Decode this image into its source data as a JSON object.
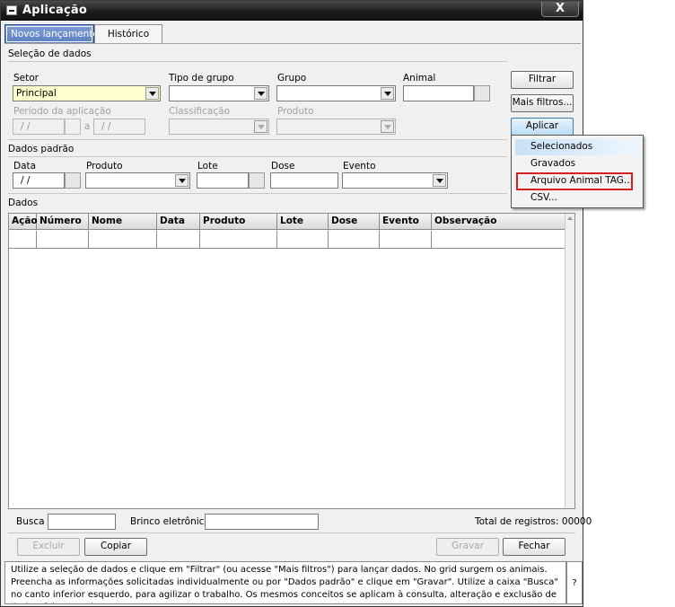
{
  "window": {
    "title": "Aplicação",
    "close_label": "X"
  },
  "tabs": [
    {
      "label": "Novos lançamentos",
      "active": true
    },
    {
      "label": "Histórico",
      "active": false
    }
  ],
  "selecao": {
    "header": "Seleção de dados",
    "setor_label": "Setor",
    "setor_value": "Principal",
    "tipo_grupo_label": "Tipo de grupo",
    "grupo_label": "Grupo",
    "animal_label": "Animal",
    "periodo_label": "Período da aplicação",
    "periodo_de": " / /",
    "periodo_sep": "a",
    "periodo_ate": " / /",
    "classificacao_label": "Classificação",
    "produto_label": "Produto"
  },
  "buttons": {
    "filtrar": "Filtrar",
    "mais_filtros": "Mais filtros...",
    "aplicar": "Aplicar"
  },
  "aplicar_menu": [
    {
      "label": "Selecionados"
    },
    {
      "label": "Gravados"
    },
    {
      "label": "Arquivo Animal TAG..."
    },
    {
      "label": "CSV..."
    }
  ],
  "dados_padrao": {
    "header": "Dados padrão",
    "data_label": "Data",
    "data_value": " / /",
    "produto_label": "Produto",
    "lote_label": "Lote",
    "dose_label": "Dose",
    "evento_label": "Evento"
  },
  "dados": {
    "header": "Dados",
    "columns": [
      "Ação",
      "Número",
      "Nome",
      "Data",
      "Produto",
      "Lote",
      "Dose",
      "Evento",
      "Observação"
    ]
  },
  "footer": {
    "busca_label": "Busca",
    "brinco_label": "Brinco eletrônico",
    "total_label": "Total de registros: 00000",
    "excluir": "Excluir",
    "copiar": "Copiar",
    "gravar": "Gravar",
    "fechar": "Fechar"
  },
  "help": {
    "text": "Utilize a seleção de dados e clique em \"Filtrar\" (ou acesse \"Mais filtros\") para lançar dados. No grid surgem os animais. Preencha as informações solicitadas individualmente ou por \"Dados padrão\" e clique em  \"Gravar\". Utilize a caixa \"Busca\" no canto inferior esquerdo, para agilizar o trabalho. Os mesmos conceitos se aplicam à consulta, alteração e exclusão de dados, feitas na aba",
    "question": "?"
  }
}
